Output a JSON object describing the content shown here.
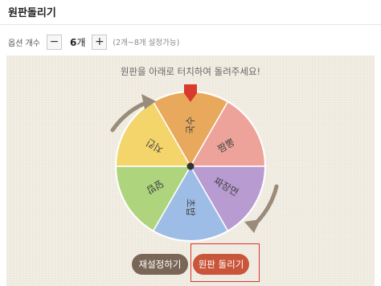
{
  "page": {
    "title": "원판돌리기"
  },
  "options": {
    "label": "옵션 개수",
    "decrement_symbol": "−",
    "increment_symbol": "+",
    "count": "6",
    "count_unit": "개",
    "hint": "(2개~8개 설정가능)"
  },
  "instruction": "원판을 아래로 터치하여 돌려주세요!",
  "wheel": {
    "segments": [
      {
        "label": "국수",
        "color": "#e8a95c"
      },
      {
        "label": "짬뽕",
        "color": "#eea39a"
      },
      {
        "label": "짜장면",
        "color": "#b89bd1"
      },
      {
        "label": "초밥",
        "color": "#9dbde6"
      },
      {
        "label": "덮밥",
        "color": "#aed57d"
      },
      {
        "label": "치킨",
        "color": "#f3d56b"
      }
    ],
    "pointer_color": "#d83a2b",
    "hub_color": "#333333"
  },
  "buttons": {
    "reset": "재설정하기",
    "spin": "원판 돌리기"
  }
}
